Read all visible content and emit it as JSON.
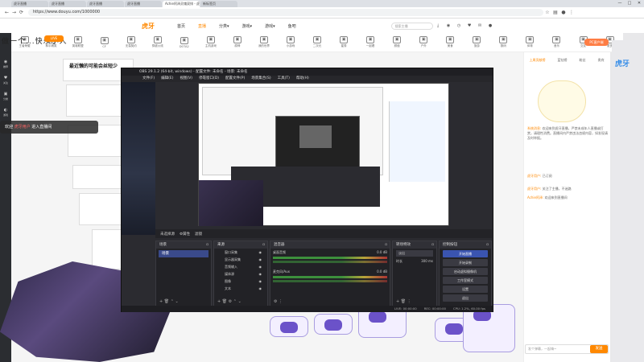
{
  "browser": {
    "tabs": [
      "虎牙直播",
      "虎牙直播",
      "虎牙直播",
      "虎牙直播",
      "Achie阿泽灵魂双排 - 虎牙直播",
      "新标签页"
    ],
    "url": "https://www.douyu.com/1000000",
    "nav": {
      "back": "←",
      "forward": "→",
      "reload": "⟳"
    },
    "win_controls": [
      "—",
      "□",
      "✕"
    ]
  },
  "site": {
    "logo": "虎牙",
    "nav": [
      {
        "label": "首页",
        "active": false
      },
      {
        "label": "直播",
        "active": true
      },
      {
        "label": "分类▾",
        "active": false
      },
      {
        "label": "游戏▾",
        "active": false
      },
      {
        "label": "游戏▾",
        "active": false
      },
      {
        "label": "鱼吧",
        "active": false
      }
    ],
    "search_placeholder": "搜索主播",
    "header_icons": [
      "下载",
      "开播",
      "历史",
      "关注",
      "消息"
    ],
    "pc_button": "PC客户端",
    "badge": "LIVE",
    "categories": [
      "王者荣耀",
      "和平精英",
      "英雄联盟",
      "CF",
      "无畏契约",
      "穿越火线",
      "DOTA2",
      "主机游戏",
      "原神",
      "我的世界",
      "小游戏",
      "二次元",
      "星秀",
      "一起看",
      "颜值",
      "户外",
      "美食",
      "旅游",
      "数码",
      "体育",
      "音乐",
      "交友",
      "更多"
    ],
    "sidebar": [
      {
        "icon": "◉",
        "label": "推荐"
      },
      {
        "icon": "♥",
        "label": "关注"
      },
      {
        "icon": "▣",
        "label": "分类"
      },
      {
        "icon": "◐",
        "label": "游戏"
      },
      {
        "icon": "⌂",
        "label": "我的"
      }
    ]
  },
  "stream": {
    "title": "最近懒的可能会丝短少",
    "welcome_prefix": "欢迎",
    "welcome_user": "虎牙用户",
    "welcome_suffix": "进入直播间",
    "overlay_text": "做一个...快乐小人"
  },
  "obs": {
    "title": "OBS 29.1.2 (64-bit, windows) - 配置文件: 未命名 - 场景: 未命名",
    "menu": [
      "文件(F)",
      "编辑(E)",
      "视图(V)",
      "停靠窗口(D)",
      "配置文件(P)",
      "场景集合(S)",
      "工具(T)",
      "帮助(H)"
    ],
    "source_bar": [
      "未选择源",
      "⚙属性",
      "滤镜"
    ],
    "scenes": {
      "header": "场景",
      "items": [
        "场景"
      ]
    },
    "sources": {
      "header": "来源",
      "items": [
        "窗口采集",
        "显示器采集",
        "音频输入",
        "媒体源",
        "图像",
        "文本"
      ]
    },
    "mixer": {
      "header": "混音器",
      "channels": [
        {
          "name": "桌面音频",
          "level": "0.0 dB"
        },
        {
          "name": "麦克风/Aux",
          "level": "0.0 dB"
        }
      ]
    },
    "transitions": {
      "header": "转场特效",
      "type": "淡出",
      "duration_label": "时长",
      "duration": "300 ms"
    },
    "controls": {
      "header": "控制按钮",
      "buttons": [
        "开始直播",
        "开始录制",
        "启动虚拟摄像机",
        "工作室模式",
        "设置",
        "退出"
      ]
    },
    "status": [
      "LIVE: 00:00:00",
      "REC: 00:00:00",
      "CPU: 1.2%, 60.00 fps"
    ]
  },
  "chat": {
    "tabs": [
      "上周贡献榜",
      "蓝钻榜",
      "粉丝",
      "贵宾"
    ],
    "messages": [
      {
        "user": "系统消息:",
        "text": "欢迎来到虎牙直播，严禁未成年人直播或打赏，请理性消费。直播间内严禁违法违规内容，如发现请及时举报。"
      },
      {
        "user": "虎牙用户:",
        "text": "已订阅"
      },
      {
        "user": "虎牙用户:",
        "text": "关注了主播，不迷路"
      },
      {
        "user": "Achie阿泽:",
        "text": "欢迎来到直播间"
      }
    ],
    "input_placeholder": "发个弹幕，一起嗨~",
    "send": "发送",
    "side_logo": "虎牙"
  },
  "colors": {
    "accent": "#ff8800",
    "obs_bg": "#2b2b30",
    "scene_sel": "#3a4a8a",
    "primary_btn": "#3a54b0"
  }
}
